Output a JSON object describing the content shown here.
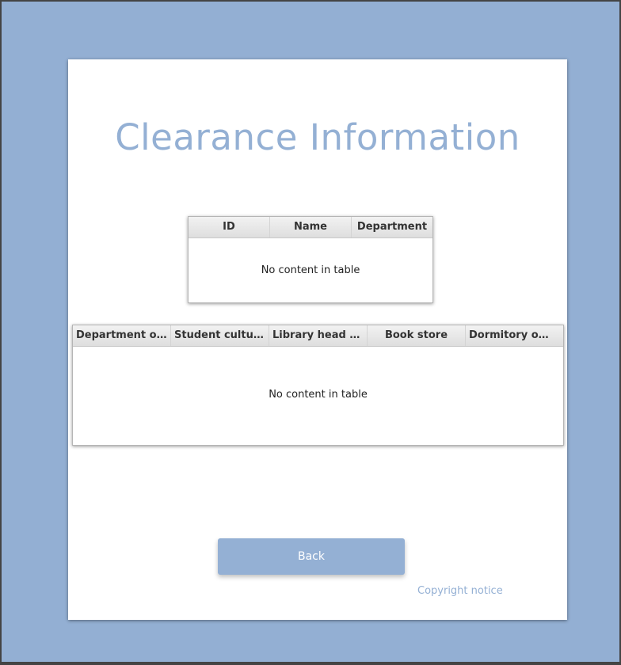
{
  "page": {
    "title": "Clearance Information"
  },
  "student_table": {
    "columns": [
      "ID",
      "Name",
      "Department"
    ],
    "placeholder": "No content in table"
  },
  "clearance_table": {
    "columns": [
      "Department off...",
      "Student cultur...",
      "Library head of...",
      "Book store",
      "Dormitory office"
    ],
    "placeholder": "No content in table"
  },
  "actions": {
    "back_label": "Back"
  },
  "footer": {
    "copyright": "Copyright notice"
  },
  "colors": {
    "background": "#93afd3",
    "accent": "#94b0d4",
    "card": "#ffffff"
  }
}
